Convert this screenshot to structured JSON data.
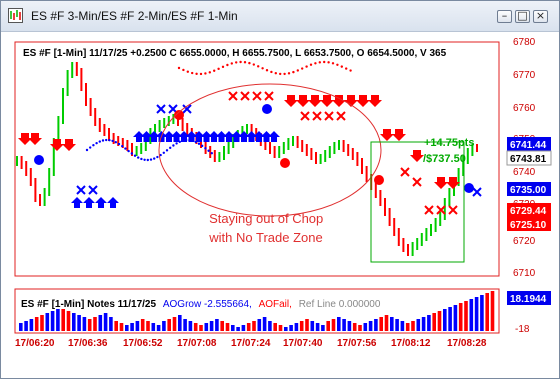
{
  "window": {
    "title": "ES #F 3-Min/ES #F 2-Min/ES #F 1-Min",
    "buttons": {
      "minimize": "–",
      "restore": "□",
      "close": "×"
    }
  },
  "main_chart": {
    "header": "ES #F [1-Min] 11/17/25  +0.2500 C 6655.0000, H 6655.7500, L 6653.7500, O 6654.5000, V 365",
    "price_scale": [
      "6780",
      "6770",
      "6760",
      "6750",
      "6740",
      "6730",
      "6720",
      "6710"
    ],
    "price_tags": {
      "current": "6743.81",
      "blue_upper": "6741.44",
      "blue_lower": "6735.00",
      "red_upper": "6729.44",
      "red_lower": "6725.10"
    },
    "annotation_chop": "Staying out of Chop\nwith No Trade Zone",
    "annotation_profit_line1": "+14.75pts",
    "annotation_profit_line2": "/$737.50"
  },
  "indicator_panel": {
    "header_prefix": "ES #F [1-Min] Notes 11/17/25",
    "aogrow_label": "AOGrow -2.555664,",
    "aofail_label": "AOFail,",
    "refline_label": "Ref Line 0.000000",
    "value_tag": "18.1944",
    "scale_bottom": "-18"
  },
  "time_axis": [
    "17/06:20",
    "17/06:36",
    "17/06:52",
    "17/07:08",
    "17/07:24",
    "17/07:40",
    "17/07:56",
    "17/08:12",
    "17/08:28"
  ],
  "colors": {
    "up_bar": "#00cc00",
    "down_bar": "#ff0000",
    "blue_signal": "#0000ff",
    "red_signal": "#ff0000",
    "profit_text": "#00aa00",
    "scale_text": "#cc0000"
  }
}
